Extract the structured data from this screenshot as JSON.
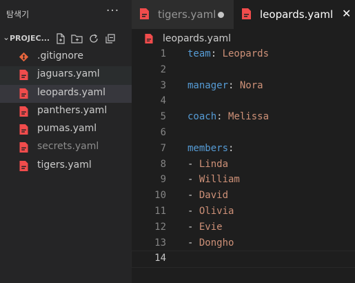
{
  "explorer": {
    "title": "탐색기",
    "more_label": "···",
    "project_name": "PROJEC...",
    "files": [
      {
        "name": ".gitignore",
        "icon": "git-icon",
        "state": ""
      },
      {
        "name": "jaguars.yaml",
        "icon": "yaml-file-icon",
        "state": "hover"
      },
      {
        "name": "leopards.yaml",
        "icon": "yaml-file-icon",
        "state": "selected"
      },
      {
        "name": "panthers.yaml",
        "icon": "yaml-file-icon",
        "state": ""
      },
      {
        "name": "pumas.yaml",
        "icon": "yaml-file-icon",
        "state": ""
      },
      {
        "name": "secrets.yaml",
        "icon": "yaml-file-icon",
        "state": "dim"
      },
      {
        "name": "tigers.yaml",
        "icon": "yaml-file-icon",
        "state": ""
      }
    ]
  },
  "tabs": [
    {
      "label": "tigers.yaml",
      "state": "modified"
    },
    {
      "label": "leopards.yaml",
      "state": "active"
    }
  ],
  "breadcrumb": {
    "file": "leopards.yaml"
  },
  "editor": {
    "current_line": 14,
    "lines": [
      {
        "n": "1",
        "parts": [
          {
            "t": "team",
            "c": "k"
          },
          {
            "t": ": ",
            "c": "p"
          },
          {
            "t": "Leopards",
            "c": "v"
          }
        ]
      },
      {
        "n": "2",
        "parts": []
      },
      {
        "n": "3",
        "parts": [
          {
            "t": "manager",
            "c": "k"
          },
          {
            "t": ": ",
            "c": "p"
          },
          {
            "t": "Nora",
            "c": "v"
          }
        ]
      },
      {
        "n": "4",
        "parts": []
      },
      {
        "n": "5",
        "parts": [
          {
            "t": "coach",
            "c": "k"
          },
          {
            "t": ": ",
            "c": "p"
          },
          {
            "t": "Melissa",
            "c": "v"
          }
        ]
      },
      {
        "n": "6",
        "parts": []
      },
      {
        "n": "7",
        "parts": [
          {
            "t": "members",
            "c": "k"
          },
          {
            "t": ":",
            "c": "p"
          }
        ]
      },
      {
        "n": "8",
        "parts": [
          {
            "t": "- ",
            "c": "p"
          },
          {
            "t": "Linda",
            "c": "v"
          }
        ]
      },
      {
        "n": "9",
        "parts": [
          {
            "t": "- ",
            "c": "p"
          },
          {
            "t": "William",
            "c": "v"
          }
        ]
      },
      {
        "n": "10",
        "parts": [
          {
            "t": "- ",
            "c": "p"
          },
          {
            "t": "David",
            "c": "v"
          }
        ]
      },
      {
        "n": "11",
        "parts": [
          {
            "t": "- ",
            "c": "p"
          },
          {
            "t": "Olivia",
            "c": "v"
          }
        ]
      },
      {
        "n": "12",
        "parts": [
          {
            "t": "- ",
            "c": "p"
          },
          {
            "t": "Evie",
            "c": "v"
          }
        ]
      },
      {
        "n": "13",
        "parts": [
          {
            "t": "- ",
            "c": "p"
          },
          {
            "t": "Dongho",
            "c": "v"
          }
        ]
      },
      {
        "n": "14",
        "parts": []
      }
    ]
  },
  "colors": {
    "yaml_icon": "#f14c4c",
    "git_icon": "#e8663d",
    "key": "#569cd6",
    "value": "#ce9178",
    "selected_row": "#37373d"
  }
}
